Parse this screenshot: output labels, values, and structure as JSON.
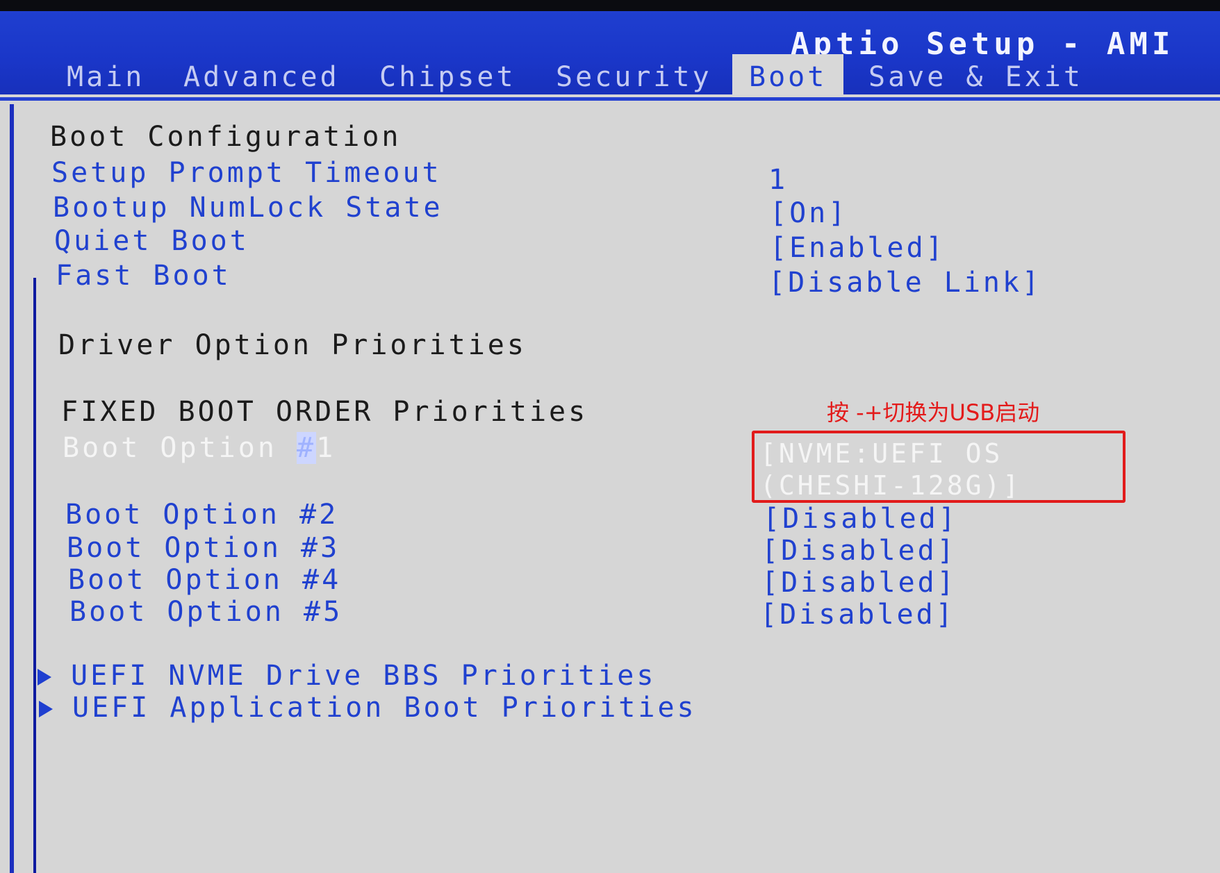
{
  "header": {
    "title": "Aptio Setup - AMI",
    "tabs": [
      {
        "label": "Main"
      },
      {
        "label": "Advanced"
      },
      {
        "label": "Chipset"
      },
      {
        "label": "Security"
      },
      {
        "label": "Boot",
        "active": true
      },
      {
        "label": "Save & Exit"
      }
    ]
  },
  "boot_config": {
    "heading": "Boot Configuration",
    "items": [
      {
        "label": "Setup Prompt Timeout",
        "value": "1"
      },
      {
        "label": "Bootup NumLock State",
        "value": "[On]"
      },
      {
        "label": "Quiet Boot",
        "value": "[Enabled]"
      },
      {
        "label": "Fast Boot",
        "value": "[Disable Link]"
      }
    ]
  },
  "driver_priorities": {
    "heading": "Driver Option Priorities"
  },
  "fixed_boot_order": {
    "heading": "FIXED BOOT ORDER Priorities",
    "option1": {
      "label_prefix": "Boot Option ",
      "label_hash": "#",
      "label_num": "1",
      "value": "[NVME:UEFI OS (CHESHI-128G)]"
    },
    "options": [
      {
        "label": "Boot Option #2",
        "value": "[Disabled]"
      },
      {
        "label": "Boot Option #3",
        "value": "[Disabled]"
      },
      {
        "label": "Boot Option #4",
        "value": "[Disabled]"
      },
      {
        "label": "Boot Option #5",
        "value": "[Disabled]"
      }
    ]
  },
  "submenus": [
    {
      "label": "UEFI NVME Drive BBS Priorities"
    },
    {
      "label": "UEFI Application Boot Priorities"
    }
  ],
  "annotation": {
    "text": "按 -+切换为USB启动",
    "color": "#e31b1b"
  },
  "colors": {
    "header_blue": "#1f3fd0",
    "panel_gray": "#d6d6d6",
    "item_blue": "#2041cf",
    "highlight_red": "#e11b1b"
  }
}
